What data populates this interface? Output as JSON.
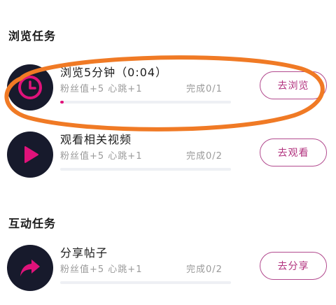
{
  "sections": {
    "browse": {
      "title": "浏览任务"
    },
    "interact": {
      "title": "互动任务"
    }
  },
  "tasks": [
    {
      "title": "浏览5分钟（0:04）",
      "rewards": "粉丝值+5 心跳+1",
      "progress_text": "完成0/1",
      "progress_fraction": 0.02,
      "button_label": "去浏览",
      "icon": "clock-icon"
    },
    {
      "title": "观看相关视频",
      "rewards": "粉丝值+5 心跳+1",
      "progress_text": "完成0/2",
      "progress_fraction": 0,
      "button_label": "去观看",
      "icon": "play-icon"
    },
    {
      "title": "分享帖子",
      "rewards": "粉丝值+5 心跳+1",
      "progress_text": "完成0/2",
      "progress_fraction": 0,
      "button_label": "去分享",
      "icon": "share-arrow-icon"
    }
  ],
  "colors": {
    "accent_pink": "#e0127a",
    "icon_background": "#171a2c",
    "button_border": "#b24a8e",
    "annotation_orange": "#f07a25"
  }
}
